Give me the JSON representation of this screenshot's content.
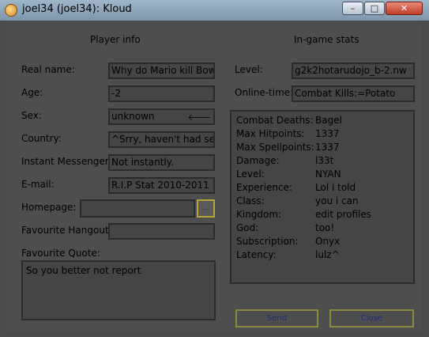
{
  "window": {
    "title": "joel34 (joel34): Kloud",
    "minimize": "–",
    "maximize": "□",
    "close": "✕",
    "icon": "app-icon"
  },
  "headers": {
    "player_info": "Player info",
    "ingame_stats": "In-game stats"
  },
  "player": [
    {
      "label": "Real name:",
      "value": "Why do Mario kill Bows"
    },
    {
      "label": "Age:",
      "value": "-2"
    },
    {
      "label": "Sex:",
      "value": "unknown"
    },
    {
      "label": "Country:",
      "value": "^Srry, haven't had sex y"
    },
    {
      "label": "Instant Messenger:",
      "value": "Not instantly."
    },
    {
      "label": "E-mail:",
      "value": "R.I.P Stat 2010-2011"
    },
    {
      "label": "Homepage:",
      "value": ""
    },
    {
      "label": "Favourite Hangout:",
      "value": ""
    }
  ],
  "homepage_button": "...",
  "sex_arrow": "🡐",
  "quote": {
    "label": "Favourite Quote:",
    "value": "So you better not report"
  },
  "level": {
    "label": "Level:",
    "value": "g2k2hotarudojo_b-2.nw"
  },
  "online": {
    "label": "Online-time:",
    "value": "Combat Kills:=Potato"
  },
  "stats": [
    {
      "key": "Combat Deaths:",
      "value": "Bagel"
    },
    {
      "key": "Max Hitpoints:",
      "value": "1337"
    },
    {
      "key": "Max Spellpoints:",
      "value": "1337"
    },
    {
      "key": "Damage:",
      "value": "l33t"
    },
    {
      "key": "Level:",
      "value": "NYAN"
    },
    {
      "key": "Experience:",
      "value": "Lol i told"
    },
    {
      "key": "Class:",
      "value": "you i can"
    },
    {
      "key": "Kingdom:",
      "value": "edit profiles"
    },
    {
      "key": "God:",
      "value": "too!"
    },
    {
      "key": "Subscription:",
      "value": "Onyx"
    },
    {
      "key": "Latency:",
      "value": "lulz^"
    }
  ],
  "buttons": {
    "send": "Send",
    "close": "Close"
  }
}
